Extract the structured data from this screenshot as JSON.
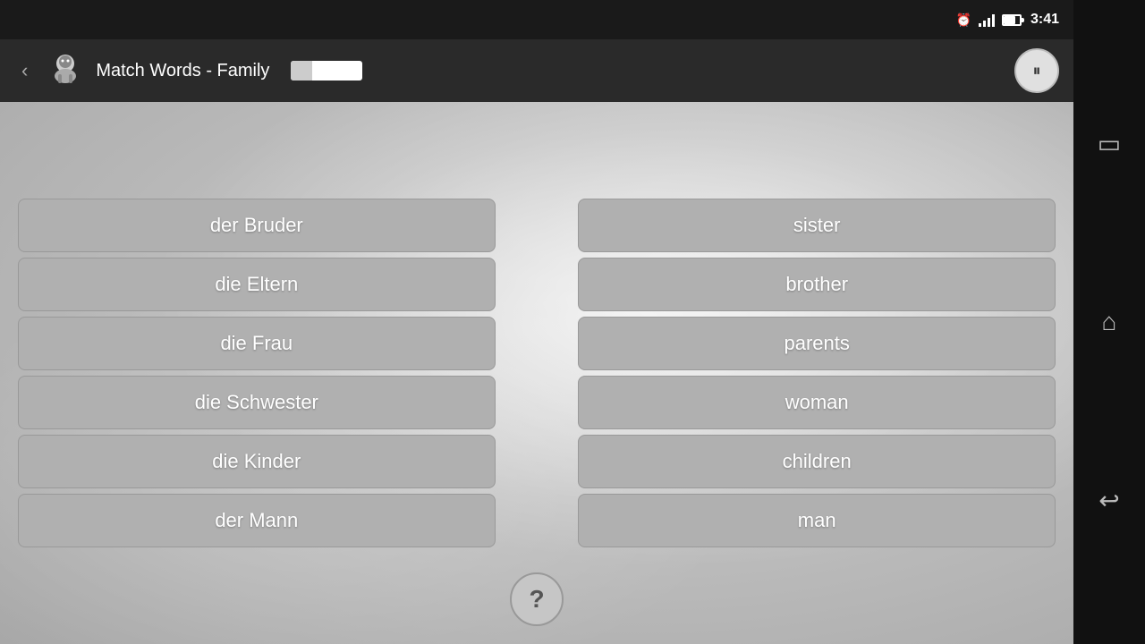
{
  "statusBar": {
    "time": "3:41"
  },
  "topBar": {
    "title": "Match Words - Family",
    "backLabel": "‹",
    "progressPercent": 30,
    "pauseIcon": "⏸"
  },
  "leftColumn": {
    "words": [
      "der Bruder",
      "die Eltern",
      "die Frau",
      "die Schwester",
      "die Kinder",
      "der Mann"
    ]
  },
  "rightColumn": {
    "words": [
      "sister",
      "brother",
      "parents",
      "woman",
      "children",
      "man"
    ]
  },
  "helpBtn": "?",
  "navBar": {
    "icons": [
      "□",
      "⌂",
      "↩"
    ]
  }
}
